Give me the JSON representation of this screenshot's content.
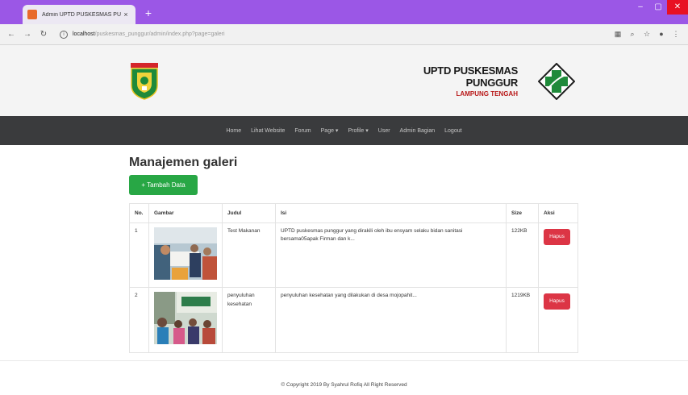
{
  "browser": {
    "tab_title": "Admin UPTD PUSKESMAS PUNG",
    "tab_close": "×",
    "new_tab": "+",
    "url_host": "localhost",
    "url_path": "/puskesmas_punggur/admin/index.php?page=galeri",
    "win_min": "–",
    "win_max": "▢",
    "win_close": "✕"
  },
  "header": {
    "brand_title": "UPTD PUSKESMAS PUNGGUR",
    "brand_subtitle": "LAMPUNG TENGAH"
  },
  "nav": {
    "items": [
      "Home",
      "Lihat Website",
      "Forum",
      "Page ▾",
      "Profile ▾",
      "User",
      "Admin Bagian",
      "Logout"
    ]
  },
  "page": {
    "title": "Manajemen galeri",
    "add_button": "+ Tambah Data"
  },
  "table": {
    "headers": [
      "No.",
      "Gambar",
      "Judul",
      "Isi",
      "Size",
      "Aksi"
    ],
    "rows": [
      {
        "no": "1",
        "judul": "Test Makanan",
        "isi": "UPTD puskesmas punggur yang dirakili oleh ibu ensyam selaku bidan sanitasi bersama05apak Firman dan k...",
        "size": "122KB",
        "aksi": "Hapus"
      },
      {
        "no": "2",
        "judul": "penyuluhan kesehatan",
        "isi": "penyuluhan kesehatan yang dilakukan di desa mojopahit...",
        "size": "1219KB",
        "aksi": "Hapus"
      }
    ]
  },
  "footer": {
    "text": "© Copyright 2019 By Syahrul Rofiq All Right Reserved"
  },
  "colors": {
    "browser_frame": "#9b57e6",
    "navbar": "#3a3b3d",
    "add_button": "#28a745",
    "delete_button": "#dc3545",
    "brand_subtitle": "#b81818"
  }
}
